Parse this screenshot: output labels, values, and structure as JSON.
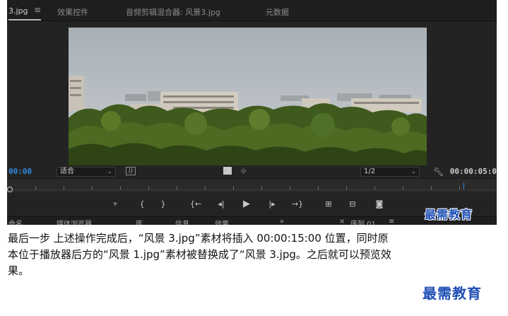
{
  "tabs": [
    {
      "label": "3.jpg",
      "menu": "≡",
      "active": true
    },
    {
      "label": "效果控件",
      "active": false
    },
    {
      "label": "音频剪辑混合器: 风景3.jpg",
      "active": false
    },
    {
      "label": "元数据",
      "active": false
    }
  ],
  "viewer": {
    "timecode_current": "00:00",
    "fit_label": "适合",
    "resolution_label": "1/2",
    "timecode_total": "00:00:05:0"
  },
  "transport": {
    "buttons": [
      {
        "name": "add-marker",
        "glyph": "▾"
      },
      {
        "name": "mark-in",
        "glyph": "{"
      },
      {
        "name": "mark-out",
        "glyph": "}"
      },
      {
        "name": "go-to-in",
        "glyph": "{←"
      },
      {
        "name": "step-back",
        "glyph": "◂|"
      },
      {
        "name": "play",
        "glyph": "▶"
      },
      {
        "name": "step-forward",
        "glyph": "|▸"
      },
      {
        "name": "go-to-out",
        "glyph": "→}"
      },
      {
        "name": "insert",
        "glyph": "⊞"
      },
      {
        "name": "overwrite",
        "glyph": "⊟"
      },
      {
        "name": "export-frame",
        "glyph": "◙"
      }
    ]
  },
  "bottom_tabs": [
    {
      "label": "命名"
    },
    {
      "label": "媒体浏览器"
    },
    {
      "label": "库"
    },
    {
      "label": "信息"
    },
    {
      "label": "效果"
    },
    {
      "label": "»"
    },
    {
      "label": "×"
    },
    {
      "label": "序列 01"
    },
    {
      "label": "≡"
    }
  ],
  "watermark": "最需教育",
  "caption": {
    "line1": "最后一步  上述操作完成后，“风景 3.jpg”素材将插入 00:00:15:00 位置，同时原",
    "line2": "本位于播放器后方的“风景 1.jpg”素材被替换成了“风景 3.jpg。之后就可以预览效",
    "line3": "果。"
  }
}
